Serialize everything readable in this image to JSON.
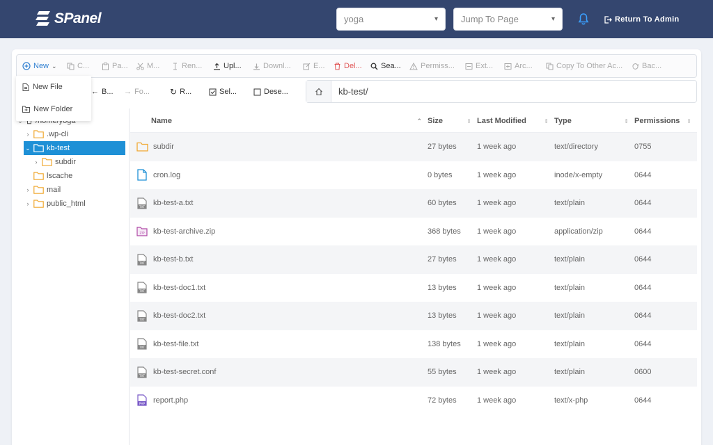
{
  "header": {
    "logo_text": "SPanel",
    "account_select": "yoga",
    "jump_placeholder": "Jump To Page",
    "return_admin": "Return To Admin",
    "bg_color": "#34466f"
  },
  "toolbar": {
    "new": "New",
    "copy": "C...",
    "paste": "Pa...",
    "move": "M...",
    "rename": "Ren...",
    "upload": "Upl...",
    "download": "Downl...",
    "edit": "E...",
    "delete": "Del...",
    "search": "Sea...",
    "permissions": "Permiss...",
    "extract": "Ext...",
    "archive": "Arc...",
    "copy_other": "Copy To Other Ac...",
    "backup": "Bac..."
  },
  "toolbar2": {
    "back": "B...",
    "forward": "Fo...",
    "reload": "R...",
    "select": "Sel...",
    "deselect": "Dese..."
  },
  "dropdown": {
    "new_file": "New File",
    "new_folder": "New Folder"
  },
  "path": "kb-test/",
  "tree": {
    "root": "/home/yoga",
    "items": [
      {
        "label": ".wp-cli"
      },
      {
        "label": "kb-test"
      },
      {
        "label": "subdir"
      },
      {
        "label": "lscache"
      },
      {
        "label": "mail"
      },
      {
        "label": "public_html"
      }
    ]
  },
  "table": {
    "headers": {
      "name": "Name",
      "size": "Size",
      "modified": "Last Modified",
      "type": "Type",
      "permissions": "Permissions"
    },
    "rows": [
      {
        "name": "subdir",
        "size": "27 bytes",
        "modified": "1 week ago",
        "type": "text/directory",
        "perm": "0755",
        "icon": "folder-icon"
      },
      {
        "name": "cron.log",
        "size": "0 bytes",
        "modified": "1 week ago",
        "type": "inode/x-empty",
        "perm": "0644",
        "icon": "file-icon"
      },
      {
        "name": "kb-test-a.txt",
        "size": "60 bytes",
        "modified": "1 week ago",
        "type": "text/plain",
        "perm": "0644",
        "icon": "txt-file-icon"
      },
      {
        "name": "kb-test-archive.zip",
        "size": "368 bytes",
        "modified": "1 week ago",
        "type": "application/zip",
        "perm": "0644",
        "icon": "zip-file-icon"
      },
      {
        "name": "kb-test-b.txt",
        "size": "27 bytes",
        "modified": "1 week ago",
        "type": "text/plain",
        "perm": "0644",
        "icon": "txt-file-icon"
      },
      {
        "name": "kb-test-doc1.txt",
        "size": "13 bytes",
        "modified": "1 week ago",
        "type": "text/plain",
        "perm": "0644",
        "icon": "txt-file-icon"
      },
      {
        "name": "kb-test-doc2.txt",
        "size": "13 bytes",
        "modified": "1 week ago",
        "type": "text/plain",
        "perm": "0644",
        "icon": "txt-file-icon"
      },
      {
        "name": "kb-test-file.txt",
        "size": "138 bytes",
        "modified": "1 week ago",
        "type": "text/plain",
        "perm": "0644",
        "icon": "txt-file-icon"
      },
      {
        "name": "kb-test-secret.conf",
        "size": "55 bytes",
        "modified": "1 week ago",
        "type": "text/plain",
        "perm": "0600",
        "icon": "txt-file-icon"
      },
      {
        "name": "report.php",
        "size": "72 bytes",
        "modified": "1 week ago",
        "type": "text/x-php",
        "perm": "0644",
        "icon": "php-file-icon"
      }
    ]
  },
  "colors": {
    "accent": "#1e90d6",
    "danger": "#e05555",
    "folder": "#f0a830"
  }
}
